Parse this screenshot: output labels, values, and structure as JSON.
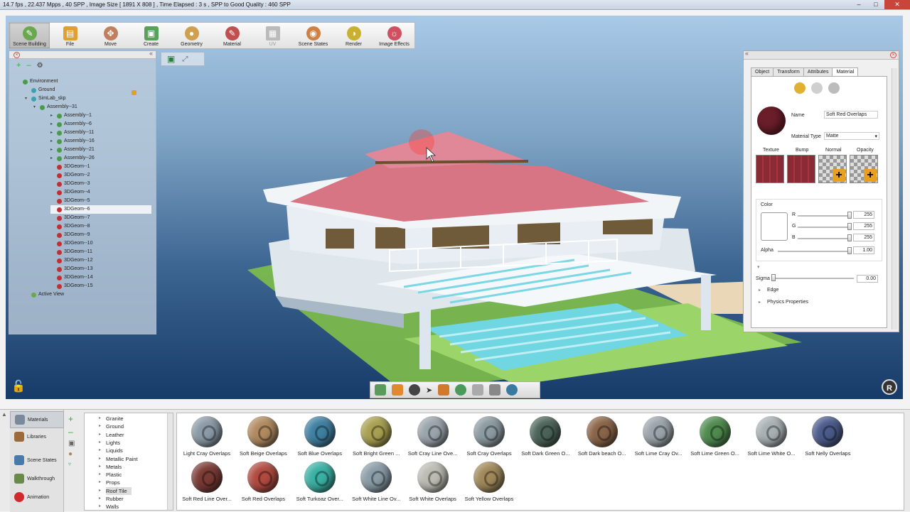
{
  "status_bar": {
    "text": "14.7 fps , 22.437 Mpps , 40 SPP , Image Size [ 1891 X 808 ] , Time Elapsed : 3 s , SPP to Good Quality : 460 SPP"
  },
  "toolbar": {
    "items": [
      {
        "label": "Scene Building",
        "icon": "scene-building-icon",
        "color": "#6aa84f"
      },
      {
        "label": "File",
        "icon": "folder-icon",
        "color": "#e0a030"
      },
      {
        "label": "Move",
        "icon": "move-icon",
        "color": "#c08060"
      },
      {
        "label": "Create",
        "icon": "cube-icon",
        "color": "#5aa05a"
      },
      {
        "label": "Geometry",
        "icon": "sphere-icon",
        "color": "#d0a050"
      },
      {
        "label": "Material",
        "icon": "paint-icon",
        "color": "#c05050"
      },
      {
        "label": "UV",
        "icon": "checker-icon",
        "color": "#bbbbbb"
      },
      {
        "label": "Scene States",
        "icon": "scene-states-icon",
        "color": "#d08040"
      },
      {
        "label": "Render",
        "icon": "render-icon",
        "color": "#c9b030"
      },
      {
        "label": "Image Effects",
        "icon": "image-effects-icon",
        "color": "#d05060"
      }
    ]
  },
  "tree": {
    "items": [
      {
        "label": "Environment",
        "depth": 0,
        "color": "#4a9a4a"
      },
      {
        "label": "Ground",
        "depth": 1,
        "color": "#40a0b0"
      },
      {
        "label": "SimLab_skp",
        "depth": 1,
        "color": "#40a0b0"
      },
      {
        "label": "Assembly--31",
        "depth": 2,
        "color": "#4a9a4a"
      },
      {
        "label": "Assembly--1",
        "depth": 3,
        "color": "#4a9a4a"
      },
      {
        "label": "Assembly--6",
        "depth": 3,
        "color": "#4a9a4a"
      },
      {
        "label": "Assembly--11",
        "depth": 3,
        "color": "#4a9a4a"
      },
      {
        "label": "Assembly--16",
        "depth": 3,
        "color": "#4a9a4a"
      },
      {
        "label": "Assembly--21",
        "depth": 3,
        "color": "#4a9a4a"
      },
      {
        "label": "Assembly--26",
        "depth": 3,
        "color": "#4a9a4a"
      },
      {
        "label": "3DGeom--1",
        "depth": 3,
        "color": "#c03030"
      },
      {
        "label": "3DGeom--2",
        "depth": 3,
        "color": "#c03030"
      },
      {
        "label": "3DGeom--3",
        "depth": 3,
        "color": "#c03030"
      },
      {
        "label": "3DGeom--4",
        "depth": 3,
        "color": "#c03030"
      },
      {
        "label": "3DGeom--5",
        "depth": 3,
        "color": "#c03030"
      },
      {
        "label": "3DGeom--6",
        "depth": 3,
        "color": "#c03030",
        "selected": true
      },
      {
        "label": "3DGeom--7",
        "depth": 3,
        "color": "#c03030"
      },
      {
        "label": "3DGeom--8",
        "depth": 3,
        "color": "#c03030"
      },
      {
        "label": "3DGeom--9",
        "depth": 3,
        "color": "#c03030"
      },
      {
        "label": "3DGeom--10",
        "depth": 3,
        "color": "#c03030"
      },
      {
        "label": "3DGeom--11",
        "depth": 3,
        "color": "#c03030"
      },
      {
        "label": "3DGeom--12",
        "depth": 3,
        "color": "#c03030"
      },
      {
        "label": "3DGeom--13",
        "depth": 3,
        "color": "#c03030"
      },
      {
        "label": "3DGeom--14",
        "depth": 3,
        "color": "#c03030"
      },
      {
        "label": "3DGeom--15",
        "depth": 3,
        "color": "#c03030"
      },
      {
        "label": "Active View",
        "depth": 1,
        "color": "#6aa84f"
      }
    ]
  },
  "properties": {
    "tabs": [
      "Object",
      "Transform",
      "Attributes",
      "Material"
    ],
    "active_tab": "Material",
    "name_label": "Name",
    "name_value": "Soft Red Overlaps",
    "material_type_label": "Material Type",
    "material_type_value": "Matte",
    "maps": [
      "Texture",
      "Bump",
      "Normal",
      "Opacity"
    ],
    "color_section": "Color",
    "r_label": "R",
    "g_label": "G",
    "b_label": "B",
    "r": "255",
    "g": "255",
    "b": "255",
    "alpha_label": "Alpha",
    "alpha": "1.00",
    "sigma_label": "Sigma",
    "sigma": "0.00",
    "edge_label": "Edge",
    "physics_label": "Physics Properties",
    "swatch_color": "#6b1e2a"
  },
  "bottom_nav": [
    {
      "label": "Materials",
      "active": true,
      "icon": "materials-icon"
    },
    {
      "label": "Libraries",
      "icon": "libraries-icon"
    },
    {
      "label": "Scene States",
      "icon": "scene-states-icon"
    },
    {
      "label": "Walkthrough",
      "icon": "walkthrough-icon"
    },
    {
      "label": "Animation",
      "icon": "animation-icon"
    }
  ],
  "categories": [
    "Granite",
    "Ground",
    "Leather",
    "Lights",
    "Liquids",
    "Metallic Paint",
    "Metals",
    "Plastic",
    "Props",
    "Roof Tile",
    "Rubber",
    "Walls"
  ],
  "selected_category": "Roof Tile",
  "materials": [
    {
      "name": "Light Cray Overlaps",
      "color": "#8a9aa6"
    },
    {
      "name": "Soft Beige Overlaps",
      "color": "#b08a60"
    },
    {
      "name": "Soft Blue Overlaps",
      "color": "#3f7fa0"
    },
    {
      "name": "Soft Bright Green ...",
      "color": "#a8a050"
    },
    {
      "name": "Soft Cray Line Ove...",
      "color": "#9aa4ac"
    },
    {
      "name": "Soft Cray Overlaps",
      "color": "#8c9aa2"
    },
    {
      "name": "Soft Dark Green O...",
      "color": "#4c6458"
    },
    {
      "name": "Soft Dark beach O...",
      "color": "#8a6448"
    },
    {
      "name": "Soft Lime Cray Ov...",
      "color": "#9aa4aa"
    },
    {
      "name": "Soft Lime Green O...",
      "color": "#4e8a4e"
    },
    {
      "name": "Soft Lime White O...",
      "color": "#a8b0b4"
    },
    {
      "name": "Soft Nelly Overlaps",
      "color": "#4a5a8a"
    },
    {
      "name": "Soft Red Line Over...",
      "color": "#7a3a34"
    },
    {
      "name": "Soft Red Overlaps",
      "color": "#b04a40"
    },
    {
      "name": "Soft Turkoaz Over...",
      "color": "#3ab0a4"
    },
    {
      "name": "Soft White Line Ov...",
      "color": "#8a9ca6"
    },
    {
      "name": "Soft White Overlaps",
      "color": "#bcbcb4"
    },
    {
      "name": "Soft Yellow Overlaps",
      "color": "#a0885a"
    }
  ]
}
